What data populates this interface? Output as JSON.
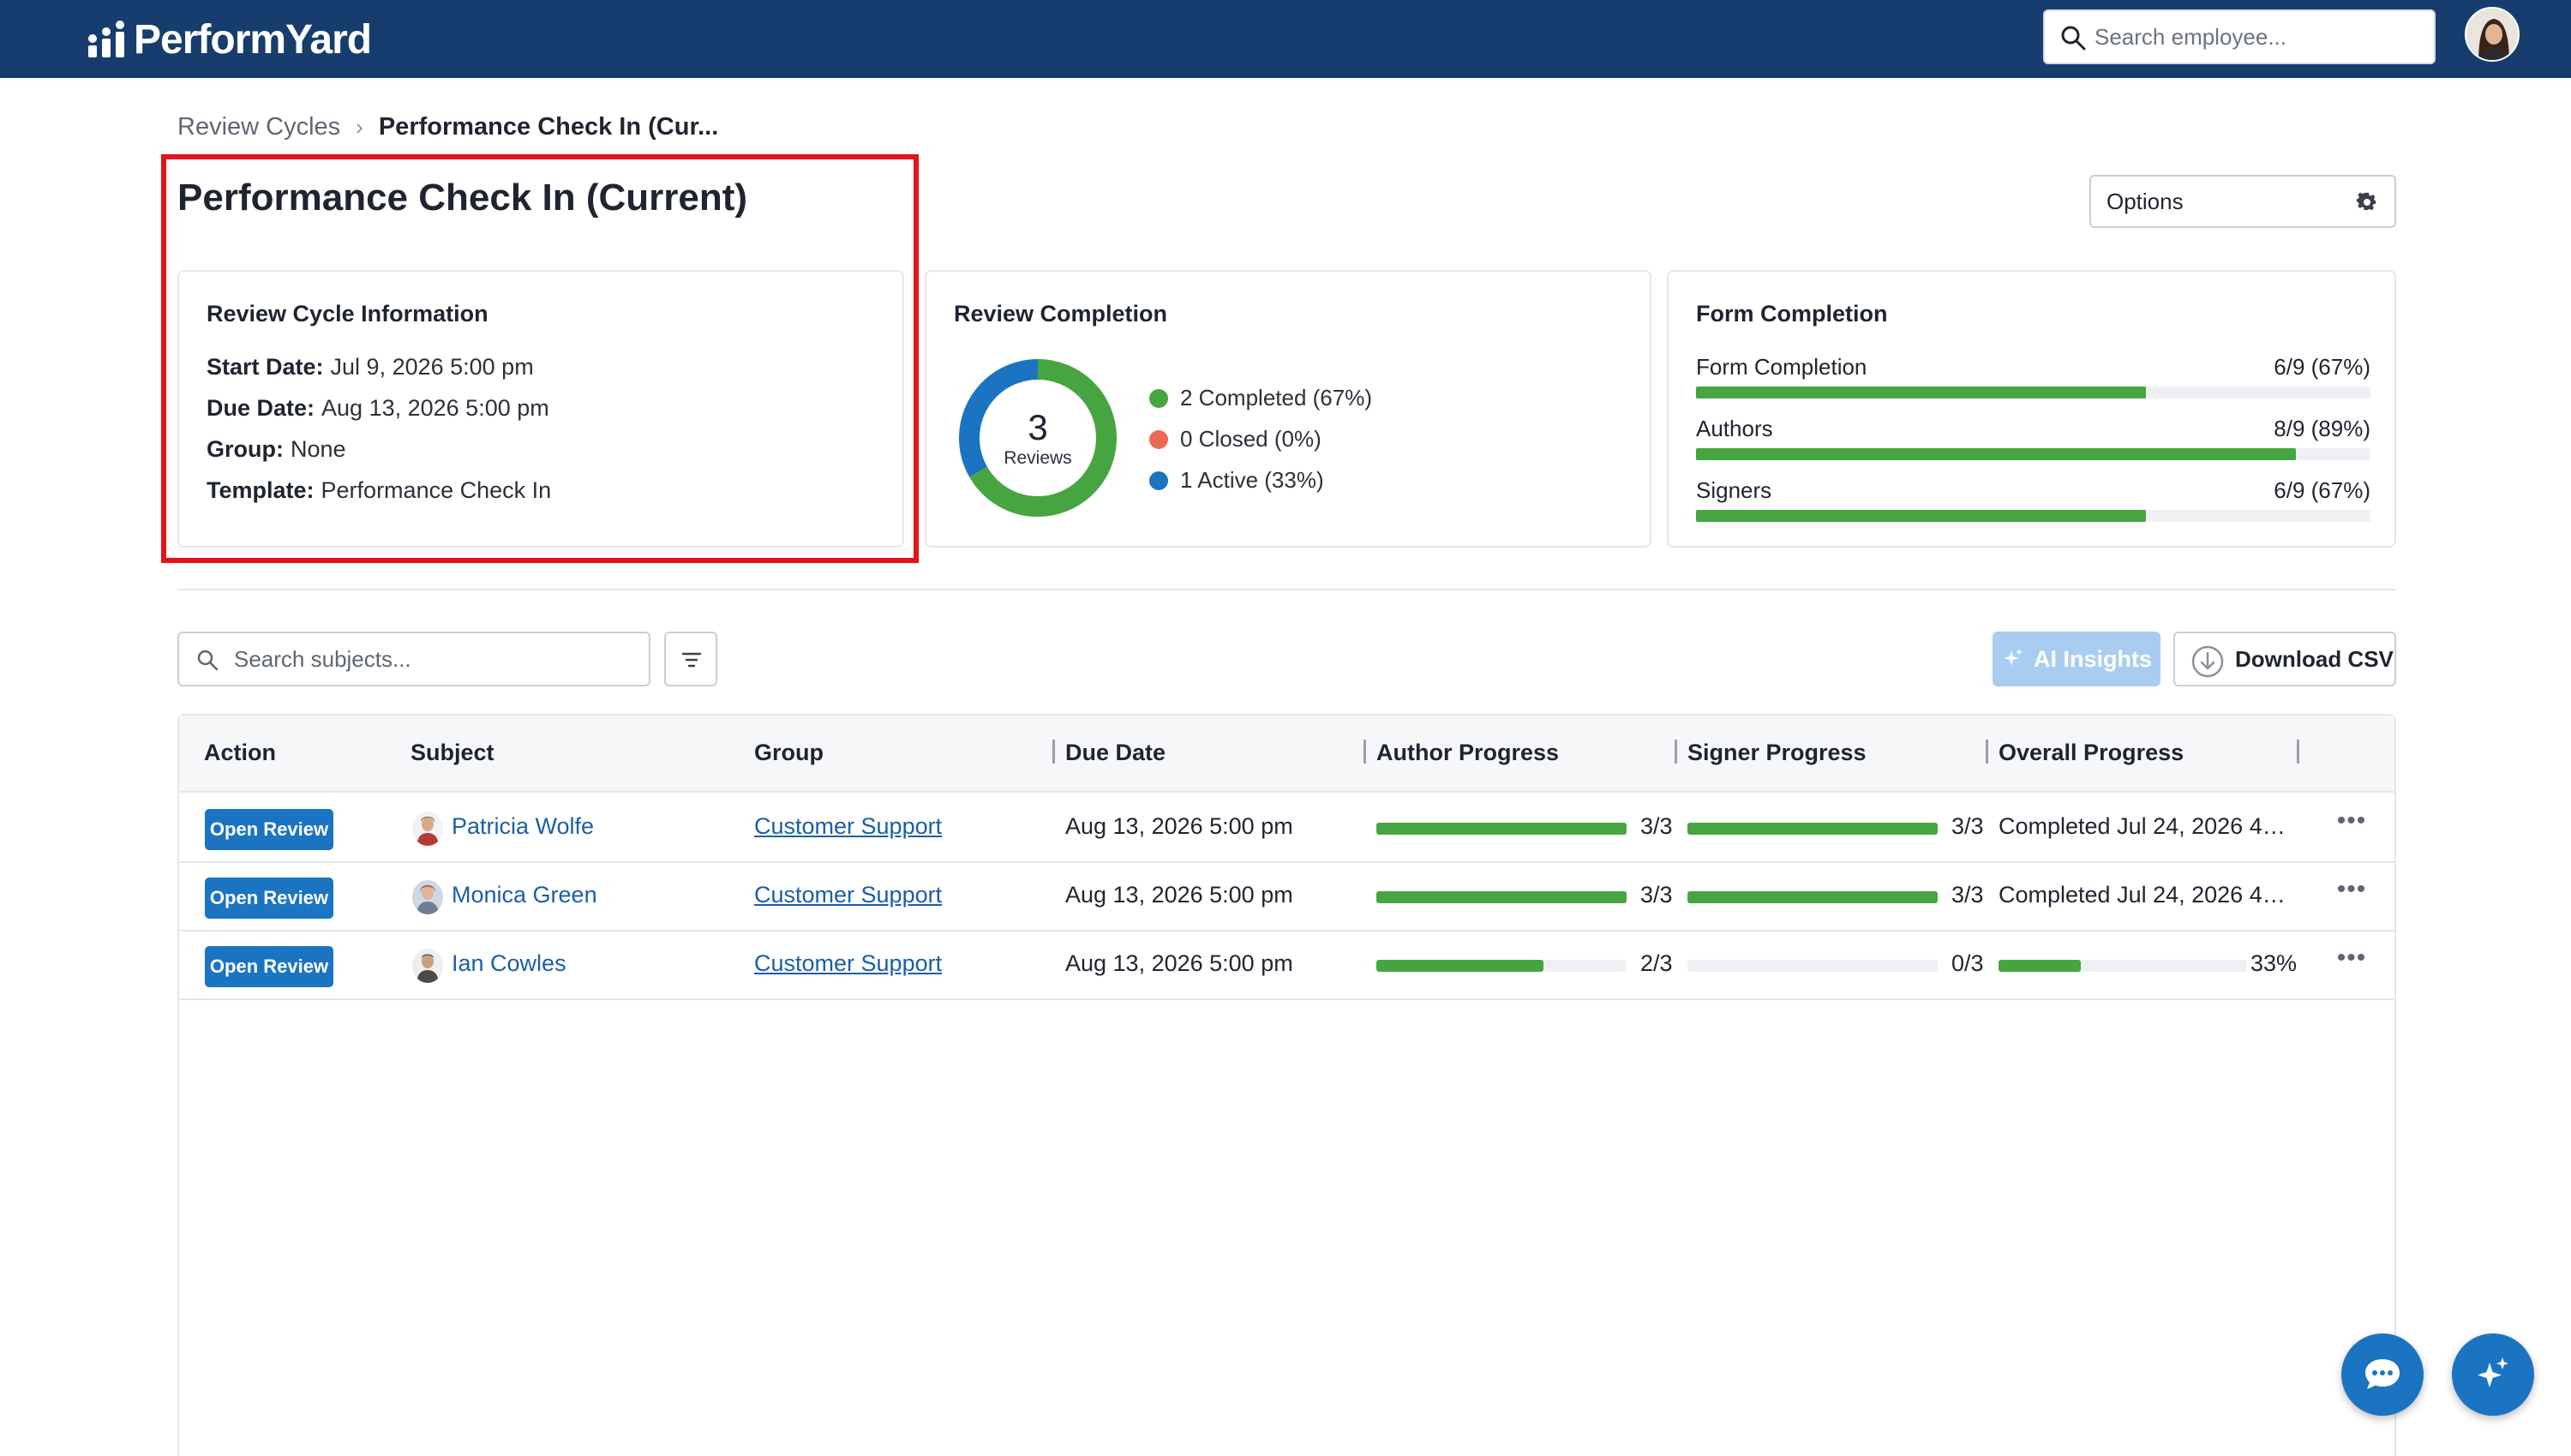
{
  "app": {
    "name": "PerformYard"
  },
  "header": {
    "search_placeholder": "Search employee..."
  },
  "breadcrumb": {
    "parent": "Review Cycles",
    "current": "Performance Check In (Cur..."
  },
  "page": {
    "title": "Performance Check In (Current)",
    "options_label": "Options"
  },
  "info_card": {
    "title": "Review Cycle Information",
    "start_label": "Start Date:",
    "start_value": "Jul 9, 2026 5:00 pm",
    "due_label": "Due Date:",
    "due_value": "Aug 13, 2026 5:00 pm",
    "group_label": "Group:",
    "group_value": "None",
    "template_label": "Template:",
    "template_value": "Performance Check In"
  },
  "review_completion": {
    "title": "Review Completion",
    "total": "3",
    "total_label": "Reviews",
    "segments": [
      {
        "label": "2 Completed (67%)",
        "fraction": 0.667,
        "color": "#47a541"
      },
      {
        "label": "0 Closed (0%)",
        "fraction": 0.0,
        "color": "#ec6a54"
      },
      {
        "label": "1 Active (33%)",
        "fraction": 0.333,
        "color": "#1b74c1"
      }
    ]
  },
  "form_completion": {
    "title": "Form Completion",
    "rows": [
      {
        "label": "Form Completion",
        "value": "6/9 (67%)",
        "fraction": 0.667
      },
      {
        "label": "Authors",
        "value": "8/9 (89%)",
        "fraction": 0.889
      },
      {
        "label": "Signers",
        "value": "6/9 (67%)",
        "fraction": 0.667
      }
    ]
  },
  "toolbar": {
    "search_placeholder": "Search subjects...",
    "ai_label": "AI Insights",
    "csv_label": "Download CSV"
  },
  "table": {
    "columns": [
      "Action",
      "Subject",
      "Group",
      "Due Date",
      "Author Progress",
      "Signer Progress",
      "Overall Progress"
    ],
    "rows": [
      {
        "action": "Open Review",
        "subject": "Patricia Wolfe",
        "group": "Customer Support",
        "due": "Aug 13, 2026 5:00 pm",
        "author_progress": "3/3",
        "author_fraction": 1.0,
        "signer_progress": "3/3",
        "signer_fraction": 1.0,
        "overall": "Completed Jul 24, 2026 4:5..."
      },
      {
        "action": "Open Review",
        "subject": "Monica Green",
        "group": "Customer Support",
        "due": "Aug 13, 2026 5:00 pm",
        "author_progress": "3/3",
        "author_fraction": 1.0,
        "signer_progress": "3/3",
        "signer_fraction": 1.0,
        "overall": "Completed Jul 24, 2026 4:5..."
      },
      {
        "action": "Open Review",
        "subject": "Ian Cowles",
        "group": "Customer Support",
        "due": "Aug 13, 2026 5:00 pm",
        "author_progress": "2/3",
        "author_fraction": 0.667,
        "signer_progress": "0/3",
        "signer_fraction": 0.0,
        "overall_percent": "33%",
        "overall_fraction": 0.33
      }
    ]
  },
  "colors": {
    "brand_navy": "#173d6e",
    "primary_blue": "#1b74c1",
    "progress_green": "#47a541",
    "highlight_red": "#e0141a"
  },
  "icons": {
    "search": "search-icon",
    "gear": "gear-icon",
    "filter": "filter-icon",
    "sparkle": "sparkle-icon",
    "download": "download-icon",
    "more": "more-horizontal-icon",
    "chat": "chat-icon"
  }
}
